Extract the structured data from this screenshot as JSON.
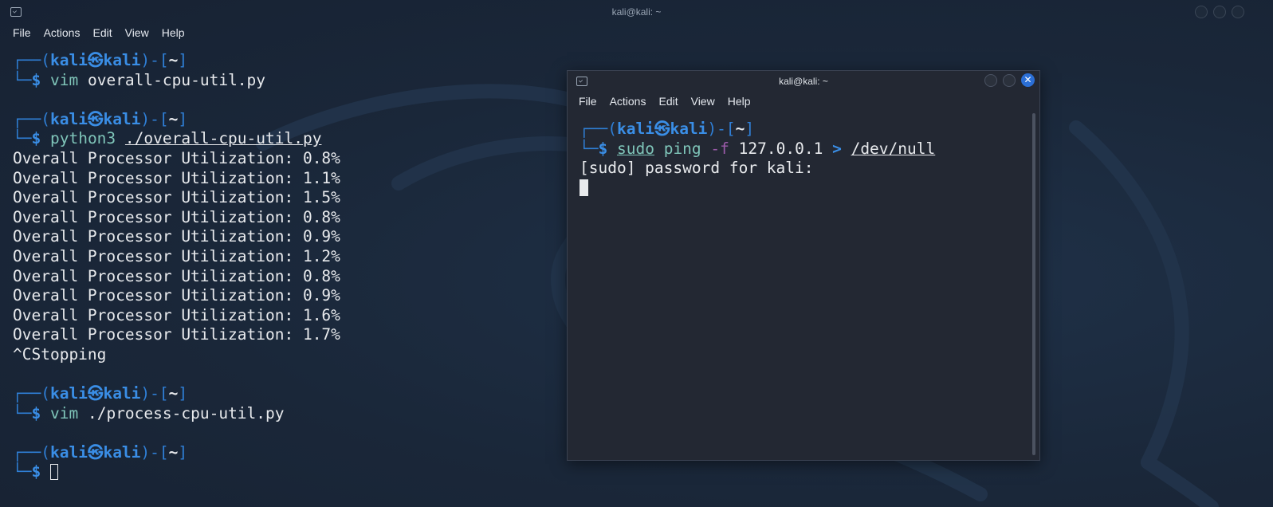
{
  "main_window": {
    "title": "kali@kali: ~",
    "menu": [
      "File",
      "Actions",
      "Edit",
      "View",
      "Help"
    ],
    "prompt": {
      "user": "kali",
      "skull": "㉿",
      "host": "kali",
      "dir": "~",
      "sign": "$"
    },
    "commands": [
      {
        "exe": "vim",
        "args": "overall-cpu-util.py"
      },
      {
        "exe": "python3",
        "args": "./overall-cpu-util.py"
      },
      {
        "exe": "vim",
        "args": "./process-cpu-util.py"
      }
    ],
    "output_prefix": "Overall Processor Utilization: ",
    "output_values": [
      "0.8%",
      "1.1%",
      "1.5%",
      "0.8%",
      "0.9%",
      "1.2%",
      "0.8%",
      "0.9%",
      "1.6%",
      "1.7%"
    ],
    "interrupt_line": "^CStopping"
  },
  "second_window": {
    "title": "kali@kali: ~",
    "menu": [
      "File",
      "Actions",
      "Edit",
      "View",
      "Help"
    ],
    "prompt": {
      "user": "kali",
      "skull": "㉿",
      "host": "kali",
      "dir": "~",
      "sign": "$"
    },
    "command": {
      "sudo": "sudo",
      "exe": "ping",
      "flag": "-f",
      "target": "127.0.0.1",
      "redir": ">",
      "path": "/dev/null"
    },
    "password_prompt": "[sudo] password for kali:"
  },
  "colors": {
    "accent_blue": "#3a8ee6",
    "command_teal": "#7fc5b9",
    "flag_purple": "#9a5aa8",
    "background": "#1c2a3e",
    "close_button": "#2b6fd6"
  }
}
